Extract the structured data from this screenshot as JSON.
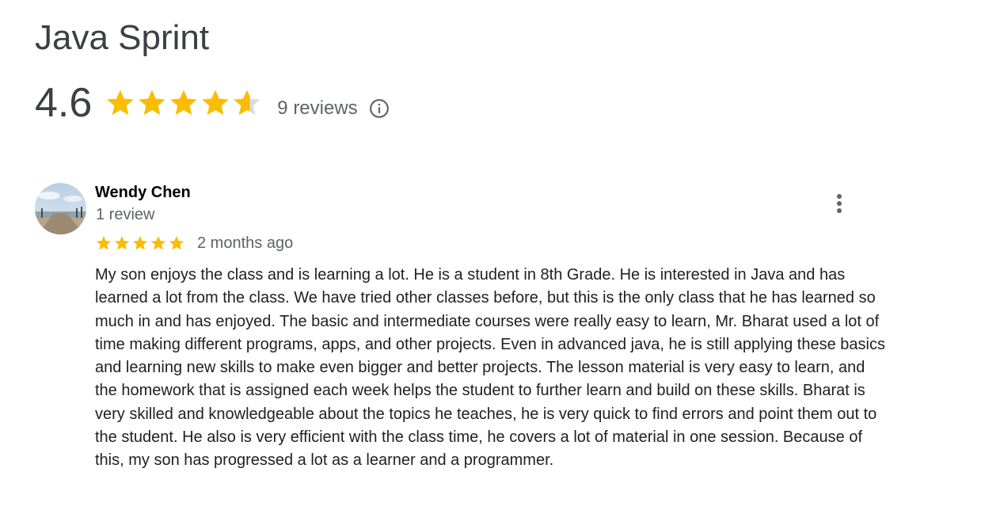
{
  "business": {
    "name": "Java Sprint",
    "average_rating": "4.6",
    "rating_value": 4.6,
    "reviews_label": "9 reviews",
    "star_color": "#fbbc04",
    "empty_star_color": "#dadce0"
  },
  "icons": {
    "info": "info-circle-icon",
    "more": "more-vert-icon",
    "star": "star-icon"
  },
  "review": {
    "author": "Wendy Chen",
    "author_meta": "1 review",
    "rating": 5,
    "date": "2 months ago",
    "text": "My son enjoys the class and is learning a lot. He is a student in 8th Grade. He is interested in Java and has learned a lot from the class. We have tried other classes before, but this is the only class that he has learned so much in and has enjoyed. The basic and intermediate courses were really easy to learn, Mr. Bharat used a lot of time making different programs, apps, and other projects. Even in advanced java, he is still applying these basics and learning new skills to make even bigger and better projects. The lesson material is very easy to learn, and the homework that is assigned each week helps the student to further learn and build on these skills. Bharat is very skilled and knowledgeable about the topics he teaches, he is very quick to find errors and point them out to the student. He also is very efficient with the class time, he covers a lot of material in one session. Because of this, my son has progressed a lot as a learner and a programmer."
  }
}
